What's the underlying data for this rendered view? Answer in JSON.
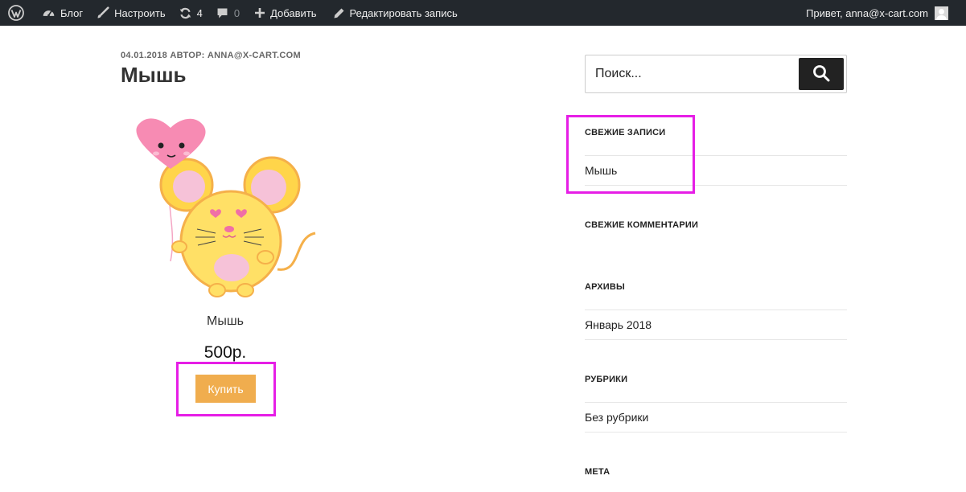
{
  "adminbar": {
    "wp_logo_icon": "wordpress-icon",
    "blog_label": "Блог",
    "customize_label": "Настроить",
    "updates_count": "4",
    "comments_count": "0",
    "add_label": "Добавить",
    "edit_post_label": "Редактировать запись",
    "greeting": "Привет, anna@x-cart.com"
  },
  "post": {
    "meta": "04.01.2018 АВТОР: ANNA@X-CART.COM",
    "title": "Мышь",
    "product_name": "Мышь",
    "price": "500р.",
    "buy_label": "Купить"
  },
  "sidebar": {
    "search_placeholder": "Поиск...",
    "widgets": [
      {
        "title": "СВЕЖИЕ ЗАПИСИ",
        "items": [
          "Мышь"
        ]
      },
      {
        "title": "СВЕЖИЕ КОММЕНТАРИИ",
        "items": []
      },
      {
        "title": "АРХИВЫ",
        "items": [
          "Январь 2018"
        ]
      },
      {
        "title": "РУБРИКИ",
        "items": [
          "Без рубрики"
        ]
      },
      {
        "title": "МЕТА",
        "items": []
      }
    ]
  },
  "colors": {
    "adminbar_bg": "#23282d",
    "buy_button": "#f0ad4e",
    "highlight": "#e61ee6",
    "search_button": "#222222"
  }
}
